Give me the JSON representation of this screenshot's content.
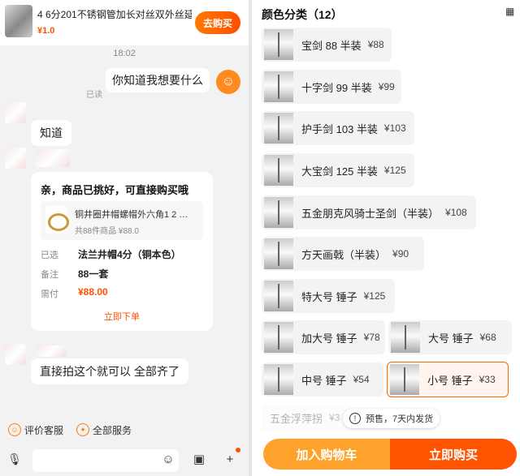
{
  "chat": {
    "product": {
      "title": "4 6分201不锈钢管加长对丝双外丝延…",
      "price": "¥1.0",
      "buy_label": "去购买"
    },
    "time": "18:02",
    "my_message": "你知道我想要什么",
    "read_label": "已读",
    "reply_know": "知道",
    "order_card": {
      "title": "亲，商品已挑好，可直接购买哦",
      "item_name": "铜井圈井帽螺帽外六角1 2 …",
      "item_sub": "共88件商品 ¥88.0",
      "rows": [
        {
          "label": "已选",
          "value": "法兰井帽4分（铜本色）"
        },
        {
          "label": "备注",
          "value": "88一套"
        },
        {
          "label": "需付",
          "value": "¥88.00"
        }
      ],
      "order_link": "立即下单"
    },
    "reply_last": "直接拍这个就可以 全部齐了",
    "quick_actions": [
      "评价客服",
      "全部服务"
    ]
  },
  "sku_panel": {
    "header": "颜色分类（12）",
    "options": [
      {
        "name": "宝剑 88 半装",
        "price": "¥88"
      },
      {
        "name": "十字剑 99 半装",
        "price": "¥99"
      },
      {
        "name": "护手剑 103 半装",
        "price": "¥103"
      },
      {
        "name": "大宝剑 125 半装",
        "price": "¥125"
      },
      {
        "name": "五金朋克风骑士圣剑（半装）",
        "price": "¥108"
      },
      {
        "name": "方天画戟（半装）",
        "price": "¥90"
      },
      {
        "name": "特大号 锤子",
        "price": "¥125"
      },
      {
        "name": "加大号 锤子",
        "price": "¥78"
      },
      {
        "name": "大号 锤子",
        "price": "¥68"
      },
      {
        "name": "中号 锤子",
        "price": "¥54"
      },
      {
        "name": "小号 锤子",
        "price": "¥33"
      },
      {
        "name": "五金浮萍拐",
        "price": "¥3"
      }
    ],
    "selected_index": 10,
    "tooltip": "预售，7天内发货",
    "add_cart_label": "加入购物车",
    "buy_now_label": "立即购买",
    "accent_color": "#ff5500"
  }
}
